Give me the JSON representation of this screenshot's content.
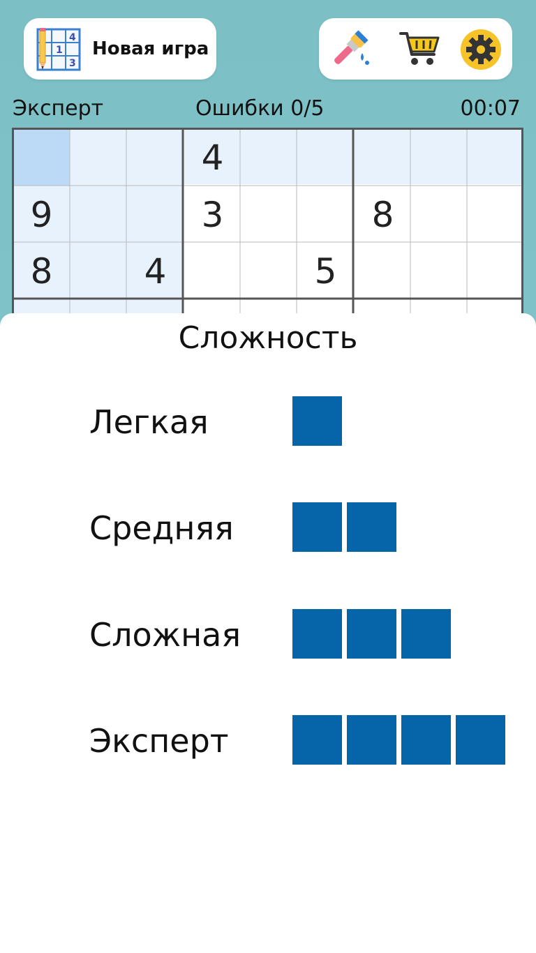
{
  "header": {
    "new_game_label": "Новая игра",
    "new_game_icon_digits": [
      "4",
      "1",
      "3"
    ]
  },
  "tools": [
    {
      "name": "paintbrush-icon"
    },
    {
      "name": "shopping-cart-icon"
    },
    {
      "name": "settings-gear-icon"
    }
  ],
  "status": {
    "level": "Эксперт",
    "errors": "Ошибки 0/5",
    "timer": "00:07"
  },
  "board": {
    "visible_rows": [
      [
        "",
        "",
        "",
        "4",
        "",
        "",
        "",
        "",
        ""
      ],
      [
        "9",
        "",
        "",
        "3",
        "",
        "",
        "8",
        "",
        ""
      ],
      [
        "8",
        "",
        "4",
        "",
        "",
        "5",
        "",
        "",
        ""
      ]
    ],
    "selected_cell": {
      "row": 1,
      "col": 1
    }
  },
  "difficulty_sheet": {
    "title": "Сложность",
    "options": [
      {
        "label": "Легкая",
        "level": 1
      },
      {
        "label": "Средняя",
        "level": 2
      },
      {
        "label": "Сложная",
        "level": 3
      },
      {
        "label": "Эксперт",
        "level": 4
      }
    ]
  },
  "colors": {
    "background": "#7cc0c6",
    "selected_cell": "#bcd9f6",
    "highlight_cell": "#e8f2fd",
    "difficulty_square": "#0565a8"
  }
}
